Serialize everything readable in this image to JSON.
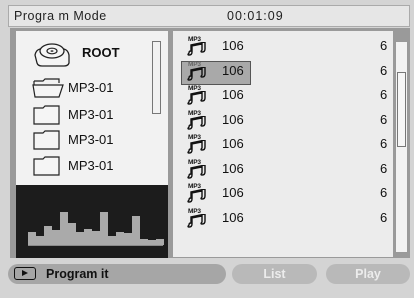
{
  "header": {
    "mode": "Progra m Mode",
    "time": "00:01:09"
  },
  "folders": [
    {
      "label": "ROOT",
      "icon": "disc-icon"
    },
    {
      "label": "MP3-01",
      "icon": "folder-open-icon"
    },
    {
      "label": "MP3-01",
      "icon": "folder-icon"
    },
    {
      "label": "MP3-01",
      "icon": "folder-icon"
    },
    {
      "label": "MP3-01",
      "icon": "folder-icon"
    }
  ],
  "tracks": [
    {
      "icon_text": "MP3",
      "num": "106",
      "count": "6",
      "selected": false
    },
    {
      "icon_text": "MP3",
      "num": "106",
      "count": "6",
      "selected": true
    },
    {
      "icon_text": "MP3",
      "num": "106",
      "count": "6",
      "selected": false
    },
    {
      "icon_text": "MP3",
      "num": "106",
      "count": "6",
      "selected": false
    },
    {
      "icon_text": "MP3",
      "num": "106",
      "count": "6",
      "selected": false
    },
    {
      "icon_text": "MP3",
      "num": "106",
      "count": "6",
      "selected": false
    },
    {
      "icon_text": "MP3",
      "num": "106",
      "count": "6",
      "selected": false
    },
    {
      "icon_text": "MP3",
      "num": "106",
      "count": "6",
      "selected": false
    }
  ],
  "buttons": {
    "program": "Program it",
    "list": "List",
    "play": "Play"
  },
  "visualizer_levels": [
    0.28,
    0.2,
    0.42,
    0.32,
    0.72,
    0.48,
    0.28,
    0.34,
    0.3,
    0.72,
    0.2,
    0.28,
    0.26,
    0.62,
    0.12,
    0.1,
    0.12
  ],
  "colors": {
    "background": "#d4d4d4",
    "selection": "#a9a9a9",
    "visualizer_bg": "#1c1c1c",
    "button_active": "#a6a6a6",
    "button_inactive": "#b9b9b9"
  }
}
